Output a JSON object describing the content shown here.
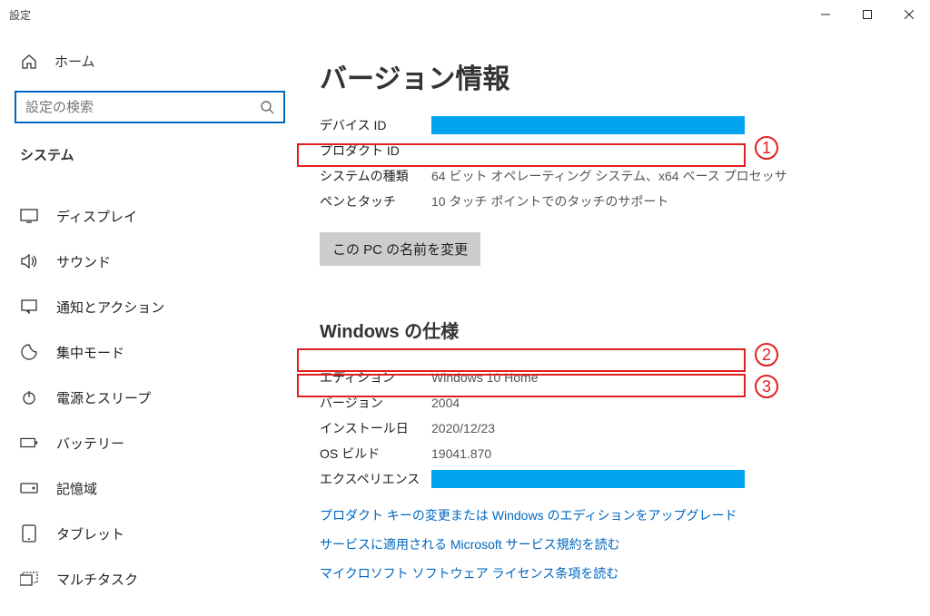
{
  "window": {
    "title": "設定"
  },
  "sidebar": {
    "home": "ホーム",
    "searchPlaceholder": "設定の検索",
    "category": "システム",
    "items": [
      {
        "icon": "display",
        "label": "ディスプレイ"
      },
      {
        "icon": "sound",
        "label": "サウンド"
      },
      {
        "icon": "notify",
        "label": "通知とアクション"
      },
      {
        "icon": "focus",
        "label": "集中モード"
      },
      {
        "icon": "power",
        "label": "電源とスリープ"
      },
      {
        "icon": "battery",
        "label": "バッテリー"
      },
      {
        "icon": "storage",
        "label": "記憶域"
      },
      {
        "icon": "tablet",
        "label": "タブレット"
      },
      {
        "icon": "multitask",
        "label": "マルチタスク"
      }
    ]
  },
  "main": {
    "title": "バージョン情報",
    "device": {
      "deviceIdLabel": "デバイス ID",
      "productIdLabel": "プロダクト ID",
      "systemTypeLabel": "システムの種類",
      "systemTypeValue": "64 ビット オペレーティング システム、x64 ベース プロセッサ",
      "penTouchLabel": "ペンとタッチ",
      "penTouchValue": "10 タッチ ポイントでのタッチのサポート"
    },
    "renameBtn": "この PC の名前を変更",
    "winSpecTitle": "Windows の仕様",
    "winSpec": {
      "editionLabel": "エディション",
      "editionValue": "Windows 10 Home",
      "versionLabel": "バージョン",
      "versionValue": "2004",
      "installedLabel": "インストール日",
      "installedValue": "2020/12/23",
      "buildLabel": "OS ビルド",
      "buildValue": "19041.870",
      "experienceLabel": "エクスペリエンス"
    },
    "links": {
      "productKey": "プロダクト キーの変更または Windows のエディションをアップグレード",
      "serviceAgreement": "サービスに適用される Microsoft サービス規約を読む",
      "license": "マイクロソフト ソフトウェア ライセンス条項を読む"
    }
  },
  "annotations": {
    "b1": "1",
    "b2": "2",
    "b3": "3"
  }
}
